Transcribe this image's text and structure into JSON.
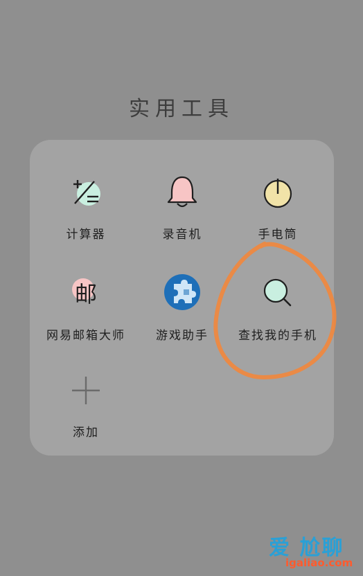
{
  "folder": {
    "title": "实用工具"
  },
  "apps": [
    {
      "label": "计算器",
      "icon": "calculator-icon"
    },
    {
      "label": "录音机",
      "icon": "bell-recorder-icon"
    },
    {
      "label": "手电筒",
      "icon": "power-flashlight-icon"
    },
    {
      "label": "网易邮箱大师",
      "icon": "mail-glyph-icon"
    },
    {
      "label": "游戏助手",
      "icon": "puzzle-game-icon"
    },
    {
      "label": "查找我的手机",
      "icon": "magnifier-icon"
    },
    {
      "label": "添加",
      "icon": "plus-icon"
    }
  ],
  "icon_glyphs": {
    "mail": "邮"
  },
  "colors": {
    "background": "#8f8f8f",
    "panel": "#a3a3a3",
    "annotation": "#f0883e",
    "mint": "#c9efe0",
    "pink": "#f7c5c5",
    "yellow": "#f1e3a8",
    "blue": "#1e6fb8"
  },
  "watermark": {
    "brand": "爱 尬聊",
    "url": "igaliao.com"
  }
}
